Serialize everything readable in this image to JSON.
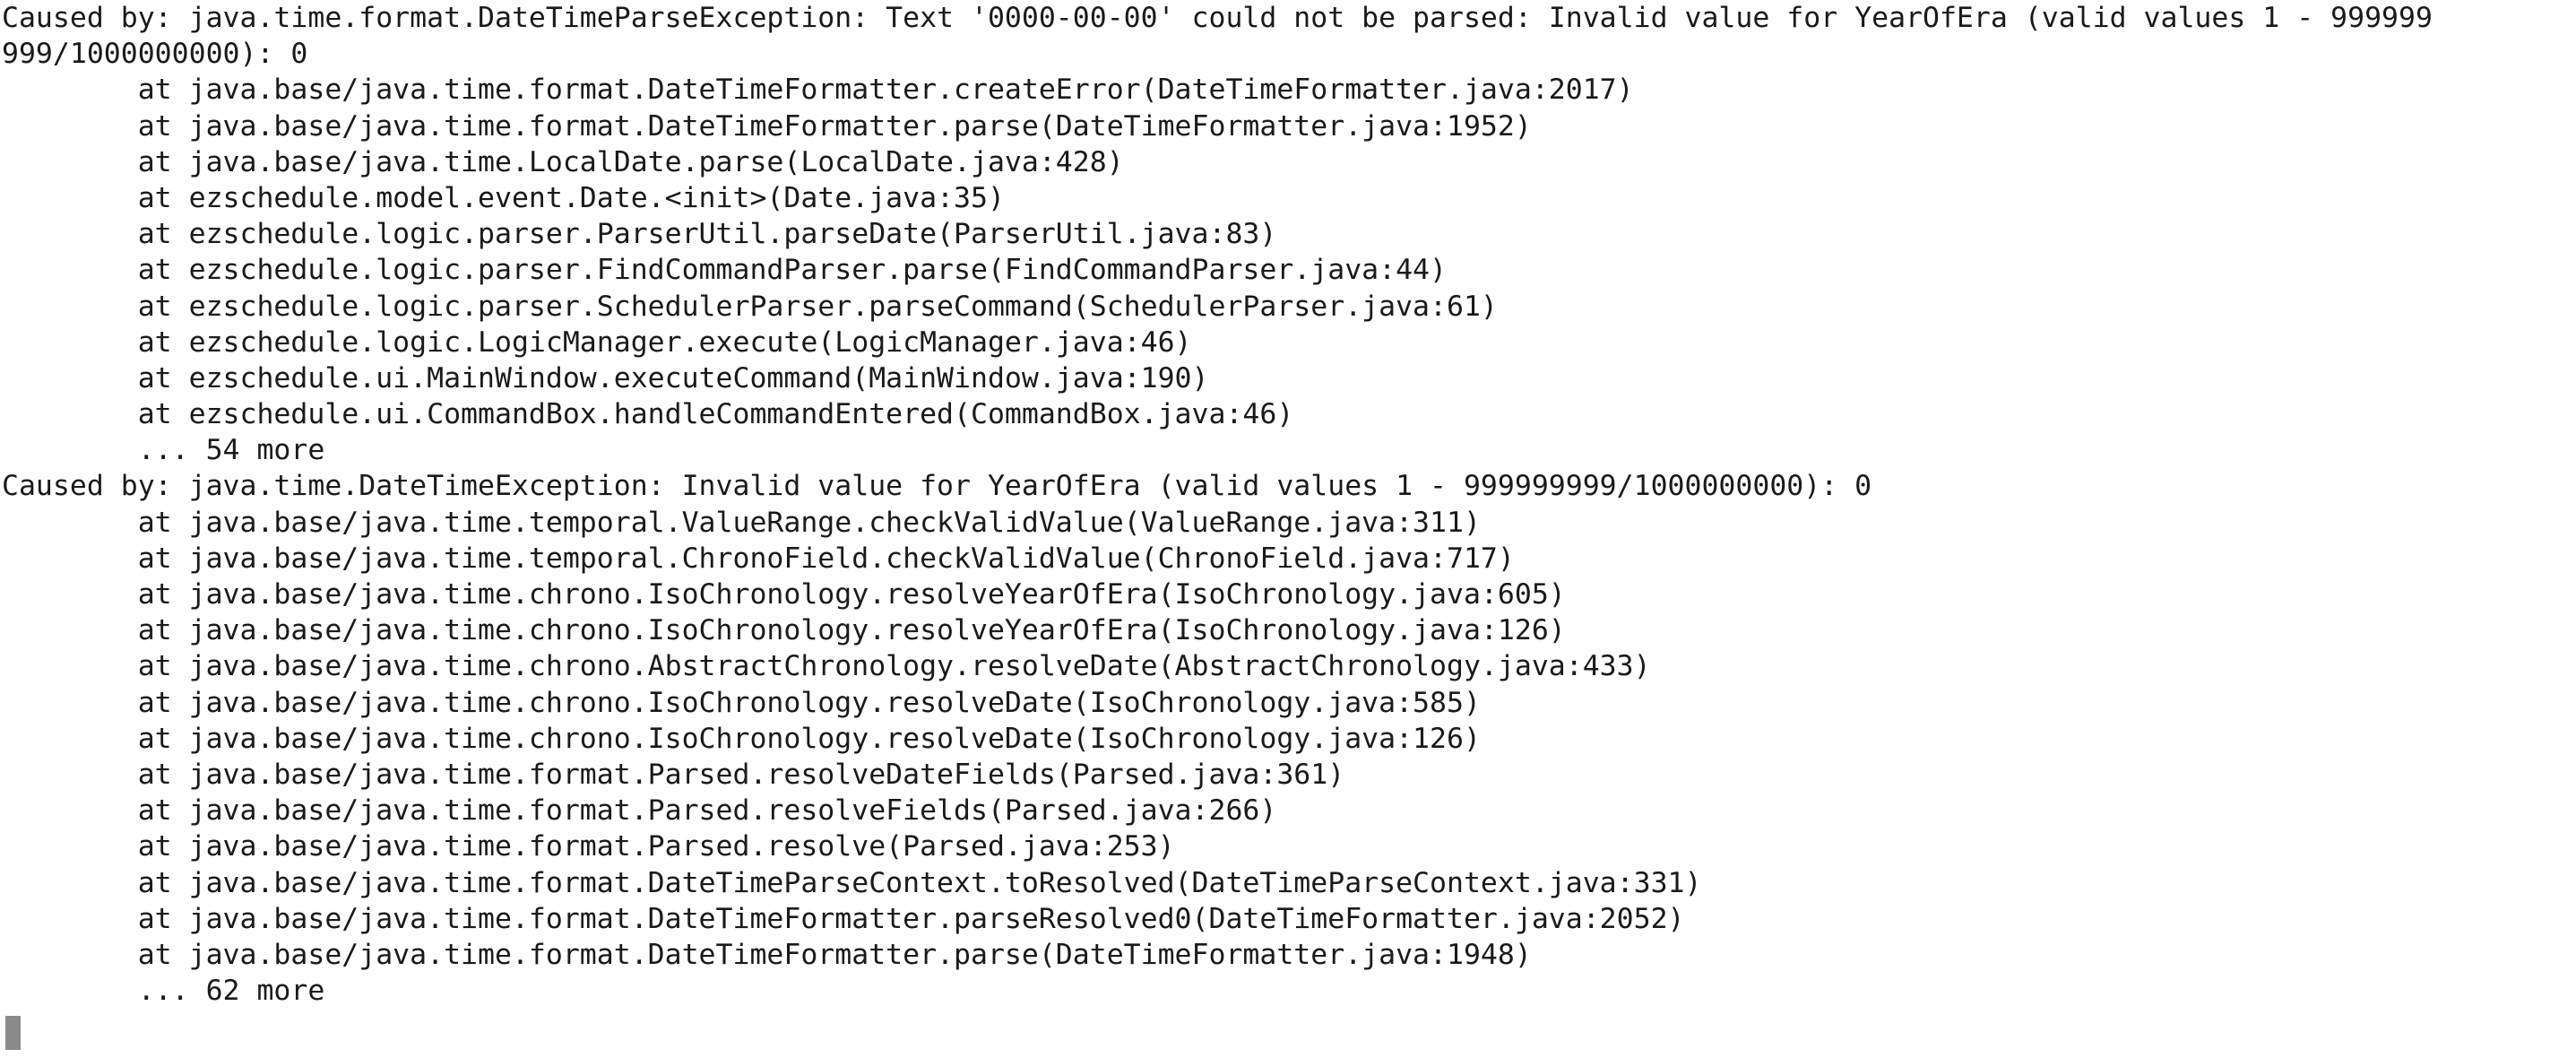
{
  "terminal": {
    "lines": [
      "Caused by: java.time.format.DateTimeParseException: Text '0000-00-00' could not be parsed: Invalid value for YearOfEra (valid values 1 - 999999",
      "999/1000000000): 0",
      "        at java.base/java.time.format.DateTimeFormatter.createError(DateTimeFormatter.java:2017)",
      "        at java.base/java.time.format.DateTimeFormatter.parse(DateTimeFormatter.java:1952)",
      "        at java.base/java.time.LocalDate.parse(LocalDate.java:428)",
      "        at ezschedule.model.event.Date.<init>(Date.java:35)",
      "        at ezschedule.logic.parser.ParserUtil.parseDate(ParserUtil.java:83)",
      "        at ezschedule.logic.parser.FindCommandParser.parse(FindCommandParser.java:44)",
      "        at ezschedule.logic.parser.SchedulerParser.parseCommand(SchedulerParser.java:61)",
      "        at ezschedule.logic.LogicManager.execute(LogicManager.java:46)",
      "        at ezschedule.ui.MainWindow.executeCommand(MainWindow.java:190)",
      "        at ezschedule.ui.CommandBox.handleCommandEntered(CommandBox.java:46)",
      "        ... 54 more",
      "Caused by: java.time.DateTimeException: Invalid value for YearOfEra (valid values 1 - 999999999/1000000000): 0",
      "        at java.base/java.time.temporal.ValueRange.checkValidValue(ValueRange.java:311)",
      "        at java.base/java.time.temporal.ChronoField.checkValidValue(ChronoField.java:717)",
      "        at java.base/java.time.chrono.IsoChronology.resolveYearOfEra(IsoChronology.java:605)",
      "        at java.base/java.time.chrono.IsoChronology.resolveYearOfEra(IsoChronology.java:126)",
      "        at java.base/java.time.chrono.AbstractChronology.resolveDate(AbstractChronology.java:433)",
      "        at java.base/java.time.chrono.IsoChronology.resolveDate(IsoChronology.java:585)",
      "        at java.base/java.time.chrono.IsoChronology.resolveDate(IsoChronology.java:126)",
      "        at java.base/java.time.format.Parsed.resolveDateFields(Parsed.java:361)",
      "        at java.base/java.time.format.Parsed.resolveFields(Parsed.java:266)",
      "        at java.base/java.time.format.Parsed.resolve(Parsed.java:253)",
      "        at java.base/java.time.format.DateTimeParseContext.toResolved(DateTimeParseContext.java:331)",
      "        at java.base/java.time.format.DateTimeFormatter.parseResolved0(DateTimeFormatter.java:2052)",
      "        at java.base/java.time.format.DateTimeFormatter.parse(DateTimeFormatter.java:1948)",
      "        ... 62 more"
    ],
    "cursor_color": "#8a8a8a"
  }
}
